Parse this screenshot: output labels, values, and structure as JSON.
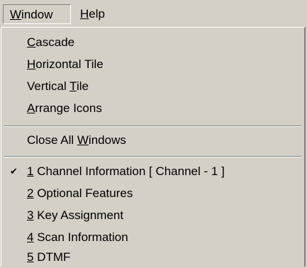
{
  "menubar": {
    "window_label_mnemonic": "W",
    "window_label_rest": "indow",
    "help_label_mnemonic": "H",
    "help_label_rest": "elp"
  },
  "window_menu": {
    "items": [
      {
        "mnemonic": "C",
        "rest": "ascade"
      },
      {
        "mnemonic": "H",
        "rest": "orizontal Tile"
      },
      {
        "pre": "Vertical ",
        "mnemonic": "T",
        "rest": "ile"
      },
      {
        "mnemonic": "A",
        "rest": "rrange Icons"
      }
    ],
    "close_all": {
      "pre": "Close All ",
      "mnemonic": "W",
      "rest": "indows"
    },
    "open_windows": [
      {
        "mnemonic": "1",
        "rest": " Channel Information [ Channel - 1 ]",
        "checked": true,
        "check_glyph": "✔"
      },
      {
        "mnemonic": "2",
        "rest": " Optional Features"
      },
      {
        "mnemonic": "3",
        "rest": " Key Assignment"
      },
      {
        "mnemonic": "4",
        "rest": " Scan Information"
      },
      {
        "mnemonic": "5",
        "rest": " DTMF"
      }
    ]
  }
}
